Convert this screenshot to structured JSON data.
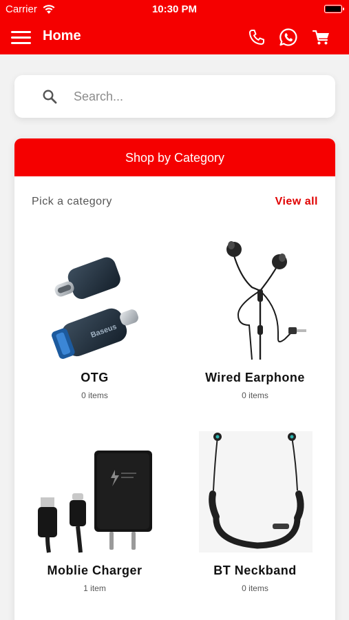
{
  "status_bar": {
    "carrier": "Carrier",
    "time": "10:30 PM"
  },
  "header": {
    "title": "Home",
    "icons": [
      "menu-icon",
      "phone-icon",
      "whatsapp-icon",
      "cart-icon"
    ]
  },
  "search": {
    "placeholder": "Search..."
  },
  "category_section": {
    "title": "Shop by Category",
    "pick_label": "Pick a category",
    "view_all_label": "View all",
    "items": [
      {
        "name": "OTG",
        "count": "0 items"
      },
      {
        "name": "Wired Earphone",
        "count": "0 items"
      },
      {
        "name": "Moblie Charger",
        "count": "1 item"
      },
      {
        "name": "BT Neckband",
        "count": "0 items"
      }
    ]
  },
  "colors": {
    "primary": "#f50000",
    "background": "#f2f2f2",
    "card": "#ffffff"
  }
}
